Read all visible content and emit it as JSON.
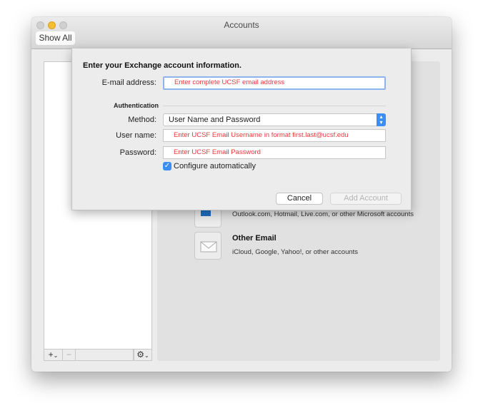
{
  "window": {
    "title": "Accounts",
    "show_all": "Show All"
  },
  "sidebar": {
    "add": "+",
    "add_menu": "⌄",
    "remove": "−",
    "gear": "⚙",
    "gear_menu": "⌄"
  },
  "accounts": [
    {
      "name": "",
      "description": "Outlook.com, Hotmail, Live.com, or other Microsoft accounts",
      "icon": "outlook-icon"
    },
    {
      "name": "Other Email",
      "description": "iCloud, Google, Yahoo!, or other accounts",
      "icon": "envelope-icon"
    }
  ],
  "sheet": {
    "heading": "Enter your Exchange account information.",
    "email_label": "E-mail address:",
    "email_value": "Enter complete UCSF email address",
    "auth_section": "Authentication",
    "method_label": "Method:",
    "method_value": "User Name and Password",
    "username_label": "User name:",
    "username_value": "Enter UCSF Email Username in format first.last@ucsf.edu",
    "password_label": "Password:",
    "password_value": "Enter UCSF Email Password",
    "configure_label": "Configure automatically",
    "configure_checked": true,
    "cancel": "Cancel",
    "add_account": "Add Account"
  },
  "colors": {
    "accent": "#3b8ef5",
    "hint_text": "#f0383e"
  }
}
